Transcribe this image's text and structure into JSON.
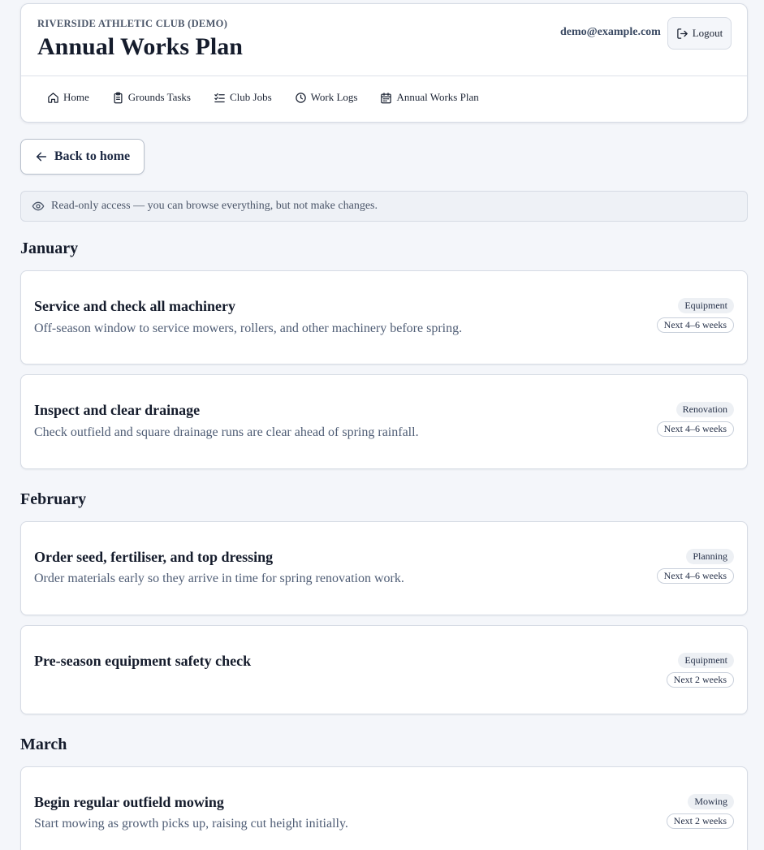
{
  "header": {
    "org": "RIVERSIDE ATHLETIC CLUB (DEMO)",
    "title": "Annual Works Plan",
    "email": "demo@example.com",
    "logout_label": "Logout"
  },
  "nav": [
    {
      "label": "Home",
      "icon": "home-icon"
    },
    {
      "label": "Grounds Tasks",
      "icon": "clipboard-icon"
    },
    {
      "label": "Club Jobs",
      "icon": "checklist-icon"
    },
    {
      "label": "Work Logs",
      "icon": "clock-icon"
    },
    {
      "label": "Annual Works Plan",
      "icon": "calendar-icon"
    }
  ],
  "back_label": "Back to home",
  "readonly_notice": "Read-only access — you can browse everything, but not make changes.",
  "months": [
    {
      "name": "January",
      "tasks": [
        {
          "title": "Service and check all machinery",
          "description": "Off-season window to service mowers, rollers, and other machinery before spring.",
          "category": "Equipment",
          "when": "Next 4–6 weeks"
        },
        {
          "title": "Inspect and clear drainage",
          "description": "Check outfield and square drainage runs are clear ahead of spring rainfall.",
          "category": "Renovation",
          "when": "Next 4–6 weeks"
        }
      ]
    },
    {
      "name": "February",
      "tasks": [
        {
          "title": "Order seed, fertiliser, and top dressing",
          "description": "Order materials early so they arrive in time for spring renovation work.",
          "category": "Planning",
          "when": "Next 4–6 weeks"
        },
        {
          "title": "Pre-season equipment safety check",
          "description": "",
          "category": "Equipment",
          "when": "Next 2 weeks"
        }
      ]
    },
    {
      "name": "March",
      "tasks": [
        {
          "title": "Begin regular outfield mowing",
          "description": "Start mowing as growth picks up, raising cut height initially.",
          "category": "Mowing",
          "when": "Next 2 weeks"
        }
      ]
    }
  ]
}
